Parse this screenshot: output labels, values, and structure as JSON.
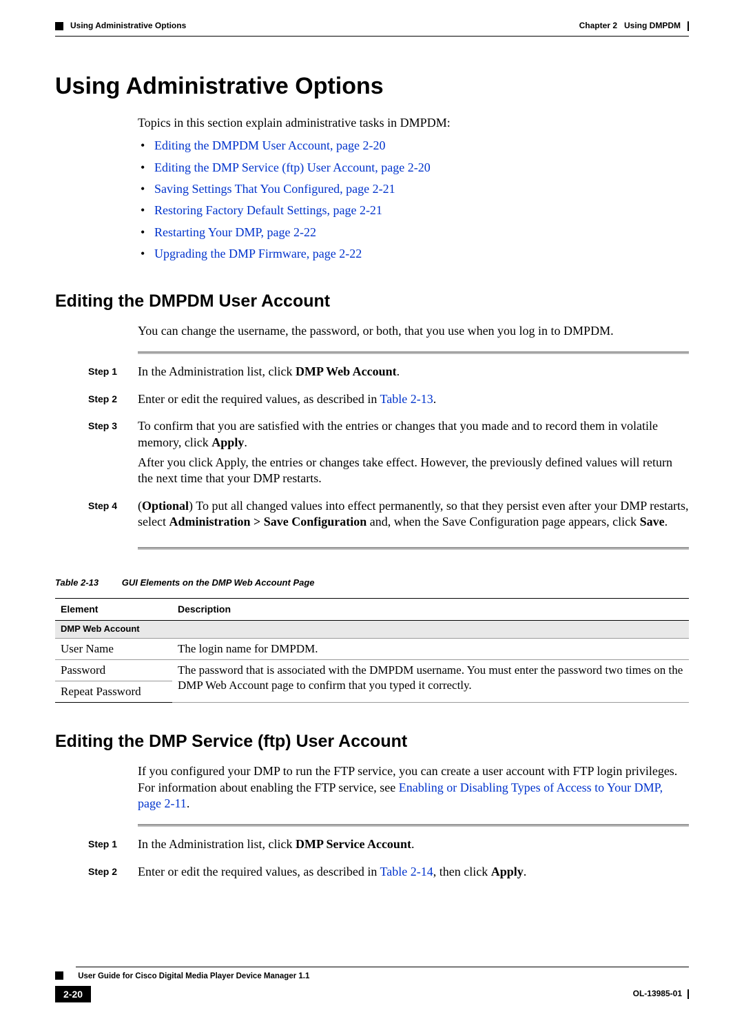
{
  "header": {
    "breadcrumb_left": "Using Administrative Options",
    "chapter_label": "Chapter 2",
    "chapter_title": "Using DMPDM"
  },
  "h1": "Using Administrative Options",
  "intro": "Topics in this section explain administrative tasks in DMPDM:",
  "toc": [
    "Editing the DMPDM User Account, page 2-20",
    "Editing the DMP Service (ftp) User Account, page 2-20",
    "Saving Settings That You Configured, page 2-21",
    "Restoring Factory Default Settings, page 2-21",
    "Restarting Your DMP, page 2-22",
    "Upgrading the DMP Firmware, page 2-22"
  ],
  "section1": {
    "heading": "Editing the DMPDM User Account",
    "intro": "You can change the username, the password, or both, that you use when you log in to DMPDM.",
    "steps": {
      "s1_label": "Step 1",
      "s1_a": "In the Administration list, click ",
      "s1_b": "DMP Web Account",
      "s1_c": ".",
      "s2_label": "Step 2",
      "s2_a": "Enter or edit the required values, as described in ",
      "s2_link": "Table 2-13",
      "s2_b": ".",
      "s3_label": "Step 3",
      "s3_a": "To confirm that you are satisfied with the entries or changes that you made and to record them in volatile memory, click ",
      "s3_b": "Apply",
      "s3_c": ".",
      "s3_after": "After you click Apply, the entries or changes take effect. However, the previously defined values will return the next time that your DMP restarts.",
      "s4_label": "Step 4",
      "s4_a": "(",
      "s4_b": "Optional",
      "s4_c": ") To put all changed values into effect permanently, so that they persist even after your DMP restarts, select ",
      "s4_d": "Administration > Save Configuration",
      "s4_e": " and, when the Save Configuration page appears, click ",
      "s4_f": "Save",
      "s4_g": "."
    }
  },
  "table": {
    "caption_num": "Table 2-13",
    "caption_title": "GUI Elements on the DMP Web Account Page",
    "col1": "Element",
    "col2": "Description",
    "section": "DMP Web Account",
    "r1c1": "User Name",
    "r1c2": "The login name for DMPDM.",
    "r2c1": "Password",
    "r23c2": "The password that is associated with the DMPDM username. You must enter the password two times on the DMP Web Account page to confirm that you typed it correctly.",
    "r3c1": "Repeat Password"
  },
  "section2": {
    "heading": "Editing the DMP Service (ftp) User Account",
    "intro_a": "If you configured your DMP to run the FTP service, you can create a user account with FTP login privileges. For information about enabling the FTP service, see ",
    "intro_link": "Enabling or Disabling Types of Access to Your DMP, page 2-11",
    "intro_b": ".",
    "steps": {
      "s1_label": "Step 1",
      "s1_a": "In the Administration list, click ",
      "s1_b": "DMP Service Account",
      "s1_c": ".",
      "s2_label": "Step 2",
      "s2_a": "Enter or edit the required values, as described in ",
      "s2_link": "Table 2-14",
      "s2_b": ", then click ",
      "s2_c": "Apply",
      "s2_d": "."
    }
  },
  "footer": {
    "guide": "User Guide for Cisco Digital Media Player Device Manager 1.1",
    "page": "2-20",
    "docid": "OL-13985-01"
  }
}
